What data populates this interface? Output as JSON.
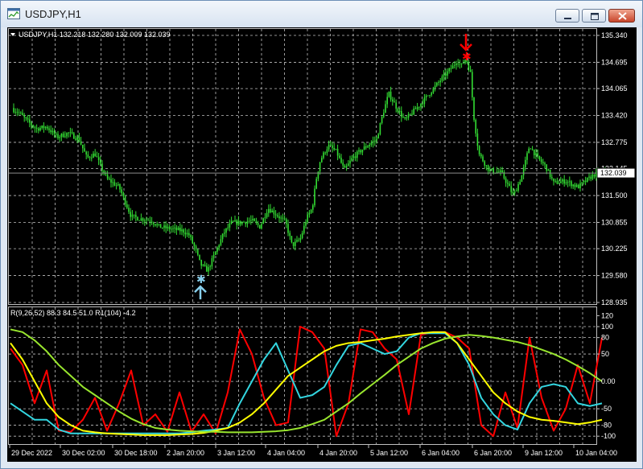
{
  "window": {
    "title": "USDJPY,H1",
    "icons": [
      "chart-app-icon",
      "minimize-icon",
      "maximize-icon",
      "close-icon"
    ]
  },
  "chart_header": {
    "text": "USDJPY,H1  132.218 132.280 132.009 132.039"
  },
  "indicator_header": {
    "text": "R(9,26,52) 88.3 84.5 51.0  R1(104) -4.2"
  },
  "colors": {
    "background": "#000000",
    "grid": "#c0c0c0",
    "candles": "#33dd33",
    "bid_line": "#8c8c8c",
    "price_label_bg": "#ffffff",
    "buy_arrow": "#87ceeb",
    "sell_arrow": "#ff0000",
    "osc_fast": "#ff0000",
    "osc_medium": "#33d6e0",
    "osc_slow": "#ffff00",
    "osc_long": "#99e62e"
  },
  "chart_data": [
    {
      "type": "line",
      "title": "",
      "symbol": "USDJPY",
      "timeframe": "H1",
      "ohlc_last": {
        "open": 132.218,
        "high": 132.28,
        "low": 132.009,
        "close": 132.039
      },
      "current_price_label": "132.039",
      "current_price": 132.039,
      "y_ticks": [
        "135.340",
        "134.695",
        "134.065",
        "133.420",
        "132.775",
        "132.145",
        "131.500",
        "130.855",
        "130.225",
        "129.580",
        "128.935"
      ],
      "ylim": [
        128.935,
        135.34
      ],
      "x_ticks": [
        "29 Dec 2022",
        "30 Dec 02:00",
        "30 Dec 18:00",
        "2 Jan 20:00",
        "3 Jan 12:00",
        "4 Jan 04:00",
        "4 Jan 20:00",
        "5 Jan 12:00",
        "6 Jan 04:00",
        "6 Jan 20:00",
        "9 Jan 12:00",
        "10 Jan 04:00"
      ],
      "x": [
        0,
        10,
        20,
        32,
        45,
        58,
        72,
        85,
        95,
        105,
        112,
        120,
        135,
        150,
        160,
        175,
        185,
        200,
        215,
        222,
        230,
        236,
        245,
        255,
        265,
        275,
        285,
        300,
        310,
        320,
        330,
        342,
        350,
        360,
        368,
        375,
        380,
        385,
        395,
        405,
        415,
        425,
        440,
        455,
        462,
        470,
        480,
        490,
        500,
        512,
        525,
        538,
        550,
        555,
        560,
        566,
        572,
        575,
        582,
        595,
        610,
        625,
        635,
        645,
        655,
        665,
        675,
        690,
        705,
        715,
        725,
        735
      ],
      "values": [
        133.6,
        133.5,
        133.3,
        133.1,
        133.15,
        132.9,
        133.0,
        132.85,
        132.4,
        132.5,
        132.2,
        131.9,
        131.7,
        131.0,
        130.95,
        130.9,
        130.75,
        130.7,
        130.65,
        130.55,
        130.2,
        129.85,
        129.7,
        130.15,
        130.6,
        130.85,
        130.85,
        130.9,
        130.75,
        131.2,
        131.05,
        130.85,
        130.3,
        130.45,
        130.95,
        131.2,
        131.9,
        132.35,
        132.7,
        132.55,
        132.1,
        132.4,
        132.65,
        132.85,
        133.4,
        133.95,
        133.6,
        133.3,
        133.5,
        133.75,
        134.05,
        134.35,
        134.6,
        134.75,
        134.6,
        134.8,
        134.4,
        133.5,
        132.5,
        132.1,
        132.05,
        131.5,
        131.95,
        132.7,
        132.4,
        132.2,
        131.8,
        131.85,
        131.7,
        131.85,
        132.0,
        132.05
      ],
      "annotations": [
        {
          "type": "buy-arrow",
          "x": 236,
          "price": 129.55,
          "color": "#87ceeb"
        },
        {
          "type": "sell-arrow",
          "x": 566,
          "price": 134.8,
          "color": "#ff0000"
        }
      ]
    },
    {
      "type": "line",
      "title": "",
      "y_ticks": [
        "120",
        "100",
        "80",
        "50",
        "0.00",
        "-50",
        "-80",
        "-100"
      ],
      "y_tick_values": [
        120,
        100,
        80,
        50,
        0,
        -50,
        -80,
        -100
      ],
      "ylim": [
        -110,
        125
      ],
      "x": [
        0,
        15,
        30,
        45,
        60,
        75,
        90,
        105,
        120,
        135,
        150,
        165,
        180,
        195,
        210,
        225,
        240,
        255,
        270,
        285,
        300,
        315,
        330,
        345,
        360,
        375,
        390,
        405,
        420,
        435,
        450,
        465,
        480,
        495,
        510,
        525,
        540,
        555,
        570,
        585,
        600,
        615,
        630,
        645,
        660,
        675,
        690,
        705,
        720,
        735
      ],
      "series": [
        {
          "color": "#ff0000",
          "values": [
            60,
            30,
            -40,
            20,
            -90,
            -92,
            -70,
            -30,
            -90,
            -40,
            20,
            -80,
            -60,
            -92,
            -20,
            -92,
            -60,
            -95,
            -20,
            95,
            50,
            -30,
            -80,
            -75,
            100,
            90,
            60,
            -100,
            -40,
            95,
            90,
            60,
            40,
            -60,
            85,
            90,
            90,
            80,
            60,
            -80,
            -100,
            -20,
            -85,
            80,
            -30,
            -90,
            -50,
            30,
            -40,
            80
          ]
        },
        {
          "color": "#33d6e0",
          "values": [
            -40,
            -55,
            -70,
            -70,
            -88,
            -95,
            -95,
            -95,
            -95,
            -95,
            -95,
            -95,
            -95,
            -95,
            -95,
            -93,
            -90,
            -88,
            -85,
            -40,
            0,
            40,
            70,
            20,
            -30,
            -25,
            -10,
            30,
            65,
            70,
            60,
            50,
            55,
            80,
            88,
            88,
            88,
            70,
            30,
            -30,
            -60,
            -80,
            -88,
            -40,
            -10,
            -5,
            -10,
            -40,
            -45,
            -40
          ]
        },
        {
          "color": "#ffff00",
          "values": [
            70,
            40,
            0,
            -40,
            -65,
            -80,
            -90,
            -93,
            -95,
            -96,
            -97,
            -98,
            -98,
            -98,
            -97,
            -96,
            -94,
            -90,
            -85,
            -75,
            -60,
            -40,
            -15,
            10,
            25,
            40,
            55,
            65,
            70,
            72,
            75,
            78,
            82,
            85,
            88,
            90,
            90,
            70,
            40,
            10,
            -20,
            -40,
            -55,
            -65,
            -70,
            -72,
            -75,
            -78,
            -75,
            -70
          ]
        },
        {
          "color": "#99e62e",
          "values": [
            95,
            90,
            75,
            55,
            30,
            10,
            -10,
            -25,
            -40,
            -55,
            -68,
            -78,
            -85,
            -88,
            -90,
            -91,
            -92,
            -92,
            -93,
            -93,
            -93,
            -92,
            -91,
            -89,
            -85,
            -78,
            -70,
            -55,
            -40,
            -22,
            -5,
            12,
            30,
            45,
            60,
            70,
            78,
            82,
            85,
            83,
            80,
            76,
            72,
            66,
            58,
            50,
            40,
            28,
            15,
            0
          ]
        }
      ]
    }
  ]
}
